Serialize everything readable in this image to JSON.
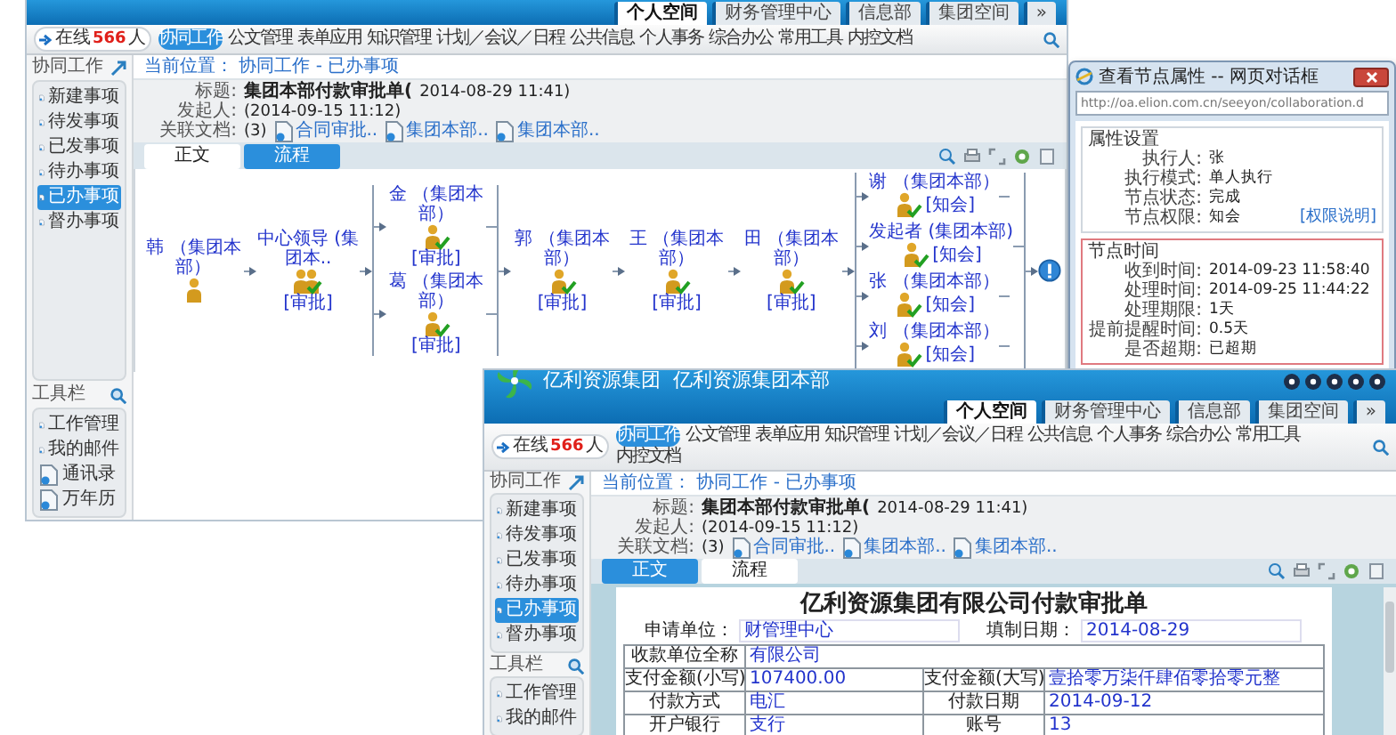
{
  "windows": [
    {
      "header_tabs": [
        {
          "label": "个人空间",
          "selected": true
        },
        {
          "label": "财务管理中心",
          "selected": false
        },
        {
          "label": "信息部",
          "selected": false
        },
        {
          "label": "集团空间",
          "selected": false
        },
        {
          "label": "»",
          "selected": false
        }
      ],
      "online": {
        "label": "在线",
        "count": "566",
        "unit": "人"
      },
      "nav": [
        {
          "label": "协同工作",
          "selected": true
        },
        {
          "label": "公文管理",
          "selected": false
        },
        {
          "label": "表单应用",
          "selected": false
        },
        {
          "label": "知识管理",
          "selected": false
        },
        {
          "label": "计划／会议／日程",
          "selected": false
        },
        {
          "label": "公共信息",
          "selected": false
        },
        {
          "label": "个人事务",
          "selected": false
        },
        {
          "label": "综合办公",
          "selected": false
        },
        {
          "label": "常用工具",
          "selected": false
        },
        {
          "label": "内控文档",
          "selected": false
        }
      ],
      "sidebar": {
        "title": "协同工作",
        "items": [
          {
            "label": "新建事项",
            "selected": false
          },
          {
            "label": "待发事项",
            "selected": false
          },
          {
            "label": "已发事项",
            "selected": false
          },
          {
            "label": "待办事项",
            "selected": false
          },
          {
            "label": "已办事项",
            "selected": true
          },
          {
            "label": "督办事项",
            "selected": false
          }
        ]
      },
      "toolbar": {
        "title": "工具栏",
        "items": [
          "工作管理",
          "我的邮件",
          "通讯录",
          "万年历"
        ]
      },
      "breadcrumb": "当前位置： 协同工作 - 已办事项",
      "fields": [
        {
          "kind": "text",
          "label": "标题:",
          "value": "集团本部付款审批单(",
          "note": "2014-08-29 11:41)"
        },
        {
          "kind": "text",
          "label": "发起人:",
          "note": "(2014-09-15 11:12)"
        },
        {
          "kind": "links",
          "label": "关联文档:",
          "count": "(3)",
          "links": [
            "合同审批..",
            "集团本部..",
            "集团本部.."
          ]
        }
      ],
      "content_tabs": [
        {
          "label": "正文",
          "selected": false
        },
        {
          "label": "流程",
          "selected": true
        }
      ],
      "content": {
        "kind": "flow",
        "steps": [
          {
            "kind": "node",
            "node": {
              "name": "韩",
              "dept": "（集团本部）",
              "done": false,
              "group": false
            }
          },
          {
            "kind": "node",
            "node": {
              "name": "中心领导",
              "dept": "(集团本..",
              "role": "[审批]",
              "done": true,
              "group": true
            }
          },
          {
            "kind": "parallel",
            "nodes": [
              {
                "name": "金",
                "dept": "（集团本部）",
                "role": "[审批]",
                "done": true,
                "group": false
              },
              {
                "name": "葛",
                "dept": "（集团本部）",
                "role": "[审批]",
                "done": true,
                "group": false
              }
            ]
          },
          {
            "kind": "node",
            "node": {
              "name": "郭",
              "dept": "（集团本部）",
              "role": "[审批]",
              "done": true,
              "group": false
            }
          },
          {
            "kind": "node",
            "node": {
              "name": "王",
              "dept": "（集团本部）",
              "role": "[审批]",
              "done": true,
              "group": false
            }
          },
          {
            "kind": "node",
            "node": {
              "name": "田",
              "dept": "（集团本部）",
              "role": "[审批]",
              "done": true,
              "group": false
            }
          },
          {
            "kind": "parallel",
            "nodes": [
              {
                "name": "谢",
                "dept": "（集团本部）",
                "role": "[知会]",
                "done": true,
                "group": false
              },
              {
                "name": "发起者",
                "dept": "(集团本部)",
                "role": "[知会]",
                "done": true,
                "group": false
              },
              {
                "name": "张",
                "dept": "（集团本部）",
                "role": "[知会]",
                "done": true,
                "group": false
              },
              {
                "name": "刘",
                "dept": "（集团本部）",
                "role": "[知会]",
                "done": true,
                "group": false
              }
            ]
          },
          {
            "kind": "end"
          }
        ]
      }
    },
    {
      "title": "亿利资源集团  亿利资源集团本部",
      "header_tabs": [
        {
          "label": "个人空间",
          "selected": true
        },
        {
          "label": "财务管理中心",
          "selected": false
        },
        {
          "label": "信息部",
          "selected": false
        },
        {
          "label": "集团空间",
          "selected": false
        },
        {
          "label": "»",
          "selected": false
        }
      ],
      "online": {
        "label": "在线",
        "count": "566",
        "unit": "人"
      },
      "nav": [
        {
          "label": "协同工作",
          "selected": true
        },
        {
          "label": "公文管理",
          "selected": false
        },
        {
          "label": "表单应用",
          "selected": false
        },
        {
          "label": "知识管理",
          "selected": false
        },
        {
          "label": "计划／会议／日程",
          "selected": false
        },
        {
          "label": "公共信息",
          "selected": false
        },
        {
          "label": "个人事务",
          "selected": false
        },
        {
          "label": "综合办公",
          "selected": false
        },
        {
          "label": "常用工具",
          "selected": false
        },
        {
          "label": "内控文档",
          "selected": false
        }
      ],
      "sidebar": {
        "title": "协同工作",
        "items": [
          {
            "label": "新建事项",
            "selected": false
          },
          {
            "label": "待发事项",
            "selected": false
          },
          {
            "label": "已发事项",
            "selected": false
          },
          {
            "label": "待办事项",
            "selected": false
          },
          {
            "label": "已办事项",
            "selected": true
          },
          {
            "label": "督办事项",
            "selected": false
          }
        ]
      },
      "toolbar": {
        "title": "工具栏",
        "items": [
          "工作管理",
          "我的邮件"
        ]
      },
      "breadcrumb": "当前位置： 协同工作 - 已办事项",
      "fields": [
        {
          "kind": "text",
          "label": "标题:",
          "value": "集团本部付款审批单(",
          "note": "2014-08-29 11:41)"
        },
        {
          "kind": "text",
          "label": "发起人:",
          "note": "(2014-09-15 11:12)"
        },
        {
          "kind": "links",
          "label": "关联文档:",
          "count": "(3)",
          "links": [
            "合同审批..",
            "集团本部..",
            "集团本部.."
          ]
        }
      ],
      "content_tabs": [
        {
          "label": "正文",
          "selected": true
        },
        {
          "label": "流程",
          "selected": false
        }
      ],
      "content": {
        "kind": "document",
        "title": "亿利资源集团有限公司付款审批单",
        "header": [
          {
            "label": "申请单位：",
            "value": "财管理中心"
          },
          {
            "label": "填制日期：",
            "value": "2014-08-29"
          }
        ],
        "rows": [
          [
            {
              "label": "收款单位全称",
              "value": "有限公司"
            }
          ],
          [
            {
              "label": "支付金额(小写)",
              "value": "107400.00"
            },
            {
              "label": "支付金额(大写)",
              "value": "壹拾零万柒仟肆佰零拾零元整"
            }
          ],
          [
            {
              "label": "付款方式",
              "value": "电汇"
            },
            {
              "label": "付款日期",
              "value": "2014-09-12"
            }
          ],
          [
            {
              "label": "开户银行",
              "value": "支行"
            },
            {
              "label": "账号",
              "value": "13"
            }
          ]
        ]
      }
    }
  ],
  "dialog": {
    "title": "查看节点属性 -- 网页对话框",
    "address": "http://oa.elion.com.cn/seeyon/collaboration.d",
    "sections": [
      {
        "title": "属性设置",
        "highlighted": false,
        "rows": [
          {
            "label": "执行人:",
            "value": "张"
          },
          {
            "label": "执行模式:",
            "value": "单人执行"
          },
          {
            "label": "节点状态:",
            "value": "完成"
          },
          {
            "label": "节点权限:",
            "value": "知会",
            "link": "[权限说明]"
          }
        ]
      },
      {
        "title": "节点时间",
        "highlighted": true,
        "rows": [
          {
            "label": "收到时间:",
            "value": "2014-09-23 11:58:40"
          },
          {
            "label": "处理时间:",
            "value": "2014-09-25 11:44:22"
          },
          {
            "label": "处理期限:",
            "value": "1天"
          },
          {
            "label": "提前提醒时间:",
            "value": "0.5天"
          },
          {
            "label": "是否超期:",
            "value": "已超期"
          }
        ]
      }
    ]
  }
}
